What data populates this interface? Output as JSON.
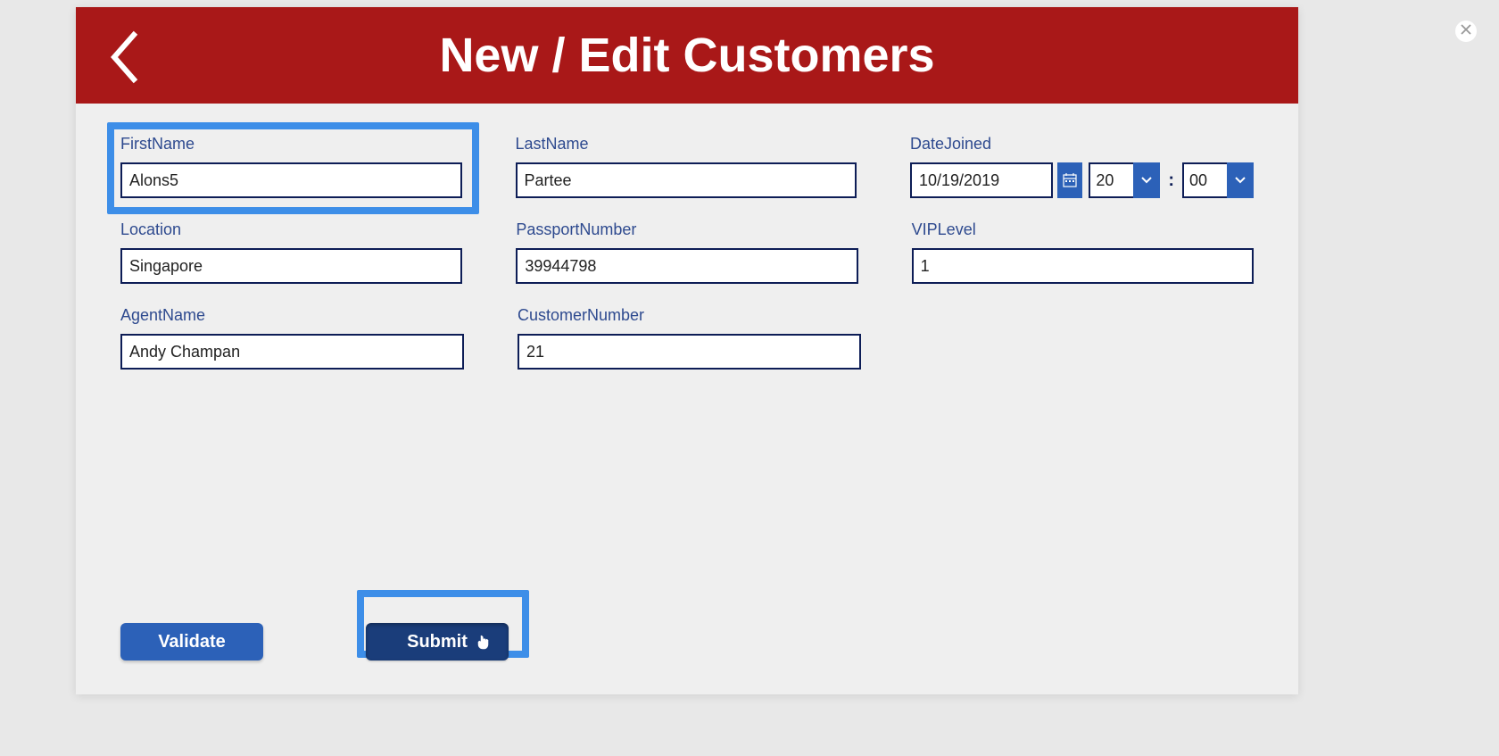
{
  "header": {
    "title": "New / Edit Customers"
  },
  "fields": {
    "firstName": {
      "label": "FirstName",
      "value": "Alons5"
    },
    "lastName": {
      "label": "LastName",
      "value": "Partee"
    },
    "dateJoined": {
      "label": "DateJoined",
      "date": "10/19/2019",
      "hour": "20",
      "minute": "00"
    },
    "location": {
      "label": "Location",
      "value": "Singapore"
    },
    "passportNumber": {
      "label": "PassportNumber",
      "value": "39944798"
    },
    "vipLevel": {
      "label": "VIPLevel",
      "value": "1"
    },
    "agentName": {
      "label": "AgentName",
      "value": "Andy Champan"
    },
    "customerNumber": {
      "label": "CustomerNumber",
      "value": "21"
    }
  },
  "buttons": {
    "validate": "Validate",
    "submit": "Submit"
  },
  "timeSeparator": ":"
}
